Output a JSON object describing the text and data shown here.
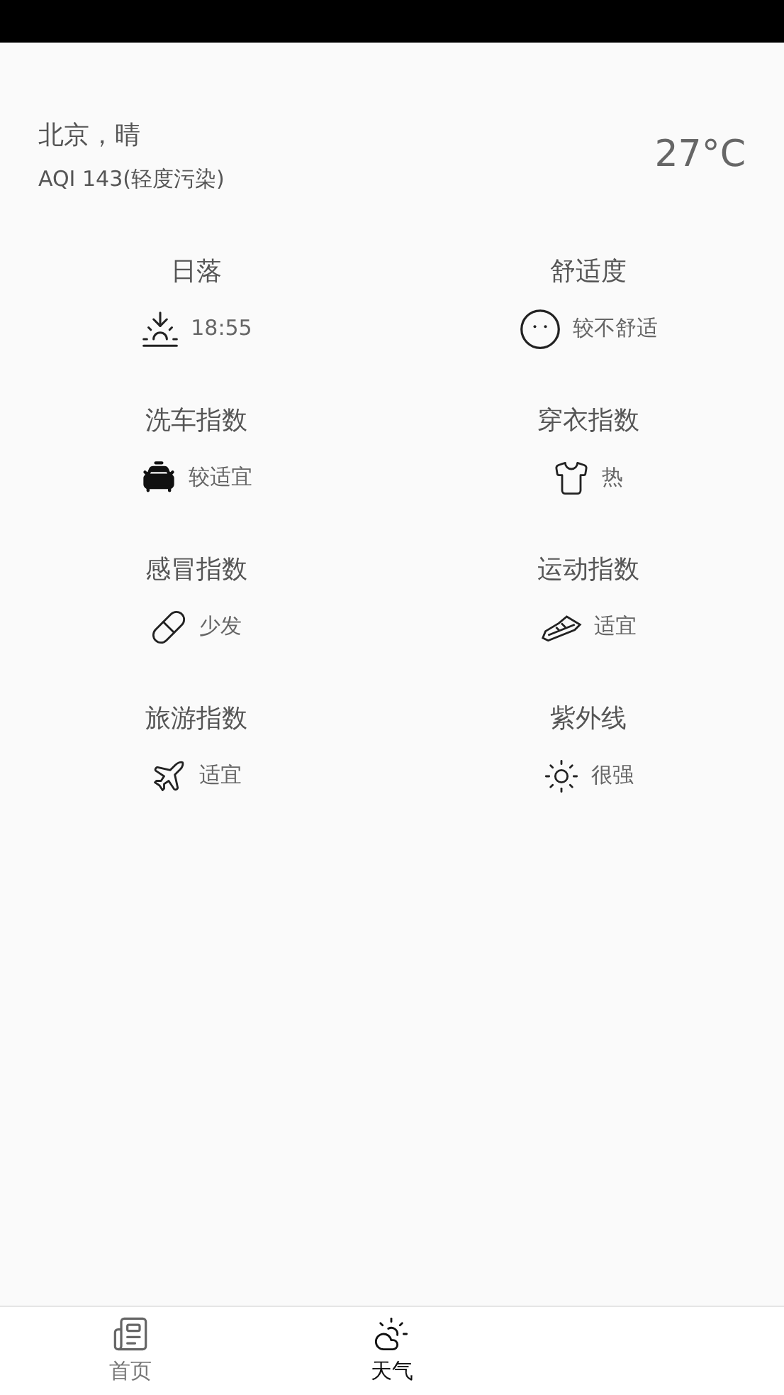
{
  "header": {
    "location": "北京，晴",
    "aqi": "AQI 143(轻度污染)",
    "temperature": "27°C"
  },
  "indices": [
    {
      "title": "日落",
      "value": "18:55"
    },
    {
      "title": "舒适度",
      "value": "较不舒适"
    },
    {
      "title": "洗车指数",
      "value": "较适宜"
    },
    {
      "title": "穿衣指数",
      "value": "热"
    },
    {
      "title": "感冒指数",
      "value": "少发"
    },
    {
      "title": "运动指数",
      "value": "适宜"
    },
    {
      "title": "旅游指数",
      "value": "适宜"
    },
    {
      "title": "紫外线",
      "value": "很强"
    }
  ],
  "tabs": [
    {
      "label": "首页",
      "selected": false
    },
    {
      "label": "天气",
      "selected": true
    }
  ]
}
